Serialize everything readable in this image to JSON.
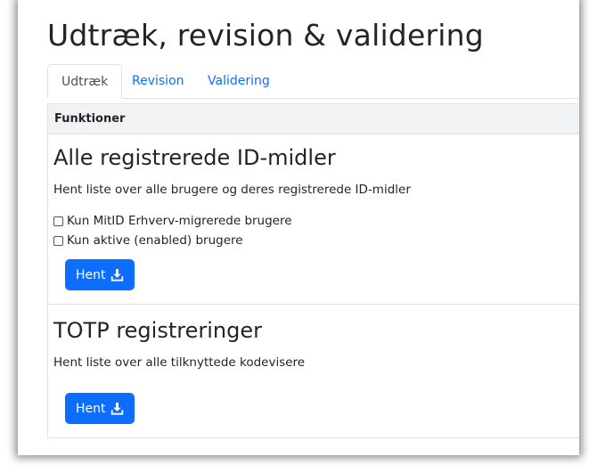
{
  "page": {
    "title": "Udtræk, revision & validering"
  },
  "tabs": [
    {
      "label": "Udtræk",
      "active": true
    },
    {
      "label": "Revision",
      "active": false
    },
    {
      "label": "Validering",
      "active": false
    }
  ],
  "card": {
    "header": "Funktioner",
    "sections": [
      {
        "heading": "Alle registrerede ID-midler",
        "description": "Hent liste over alle brugere og deres registrerede ID-midler",
        "checkboxes": [
          {
            "label": "Kun MitID Erhverv-migrerede brugere",
            "checked": false
          },
          {
            "label": "Kun aktive (enabled) brugere",
            "checked": false
          }
        ],
        "button_label": "Hent",
        "button_icon": "download-icon"
      },
      {
        "heading": "TOTP registreringer",
        "description": "Hent liste over alle tilknyttede kodevisere",
        "button_label": "Hent",
        "button_icon": "download-icon"
      }
    ]
  },
  "colors": {
    "primary": "#0d6efd",
    "text": "#212529",
    "border": "#dee2e6",
    "header_bg": "#f1f2f4"
  }
}
